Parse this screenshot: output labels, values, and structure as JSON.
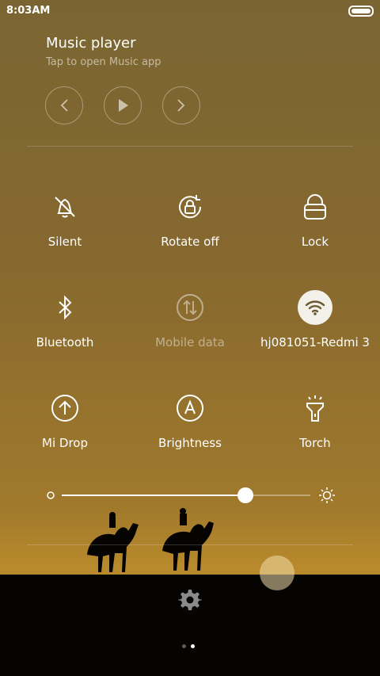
{
  "status_bar": {
    "time": "8:03AM",
    "battery_level": 1.0
  },
  "music": {
    "title": "Music player",
    "subtitle": "Tap to open Music app",
    "controls": [
      "previous-icon",
      "play-icon",
      "next-icon"
    ]
  },
  "toggles": [
    {
      "label": "Silent",
      "icon": "bell-off-icon",
      "state": "off"
    },
    {
      "label": "Rotate off",
      "icon": "rotate-lock-icon",
      "state": "off"
    },
    {
      "label": "Lock",
      "icon": "lock-icon",
      "state": "off"
    },
    {
      "label": "Bluetooth",
      "icon": "bluetooth-icon",
      "state": "off"
    },
    {
      "label": "Mobile data",
      "icon": "mobile-data-icon",
      "state": "disabled"
    },
    {
      "label": "hj081051-Redmi 3",
      "icon": "wifi-icon",
      "state": "on"
    },
    {
      "label": "Mi Drop",
      "icon": "upload-icon",
      "state": "off"
    },
    {
      "label": "Brightness",
      "icon": "auto-brightness-icon",
      "state": "off"
    },
    {
      "label": "Torch",
      "icon": "torch-icon",
      "state": "off"
    }
  ],
  "brightness": {
    "level": 0.74
  },
  "pager": {
    "pages": 2,
    "current": 2
  },
  "colors": {
    "background_top": "#7a6532",
    "background_bottom": "#b98a2c",
    "ground": "#050403"
  }
}
